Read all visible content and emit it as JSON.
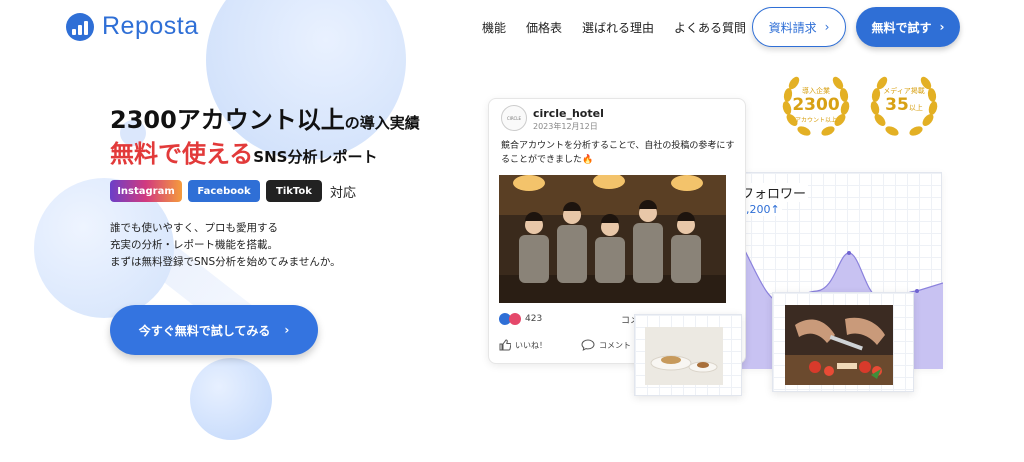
{
  "brand": {
    "name": "Reposta"
  },
  "nav": {
    "items": [
      "機能",
      "価格表",
      "選ばれる理由",
      "よくある質問"
    ],
    "request_docs_label": "資料請求",
    "free_trial_label": "無料で試す"
  },
  "hero": {
    "headline_main": "2300アカウント以上",
    "headline_suffix": "の導入実績",
    "tagline_red": "無料で使える",
    "tagline_rest": "SNS分析レポート",
    "platforms": [
      "Instagram",
      "Facebook",
      "TikTok"
    ],
    "platforms_suffix": "対応",
    "description": [
      "誰でも使いやすく、プロも愛用する",
      "充実の分析・レポート機能を搭載。",
      "まずは無料登録でSNS分析を始めてみませんか。"
    ],
    "cta_label": "今すぐ無料で試してみる"
  },
  "awards": [
    {
      "top": "導入企業",
      "value": "2300",
      "bottom": "アカウント以上"
    },
    {
      "top": "メディア掲載",
      "value": "35",
      "unit": "以上"
    }
  ],
  "post": {
    "avatar_text": "CIRCLE",
    "account": "circle_hotel",
    "date": "2023年12月12日",
    "text": "競合アカウントを分析することで、自社の投稿の参考にすることができました🔥",
    "reaction_count": "423",
    "comments_label": "コメント",
    "like_label": "いいね！",
    "comment_label": "コメント"
  },
  "follower_chart": {
    "title": "フォロワー",
    "value": "1,200↑"
  },
  "colors": {
    "brand": "#2f6fd6",
    "accent_red": "#e23a3a",
    "award_gold": "#d8a114"
  },
  "icons": {
    "chevron": "chevron-right-icon",
    "like": "thumbs-up-icon",
    "comment": "comment-bubble-icon",
    "fire": "fire-icon"
  }
}
